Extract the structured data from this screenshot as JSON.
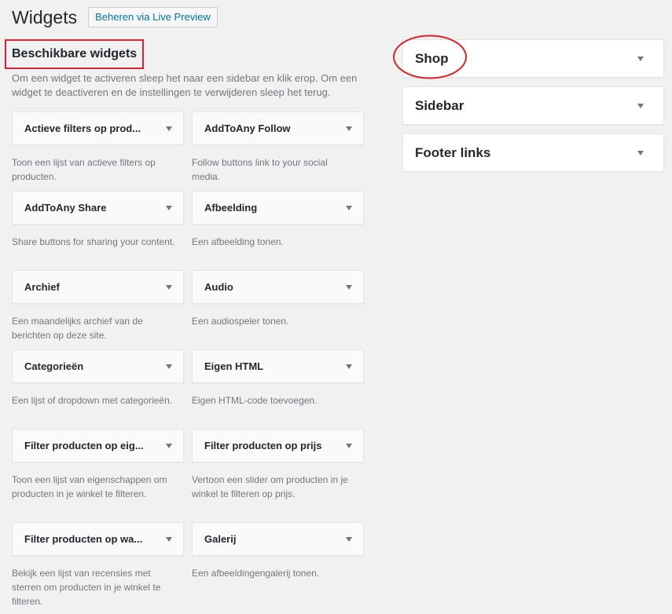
{
  "header": {
    "title": "Widgets",
    "live_preview_label": "Beheren via Live Preview"
  },
  "available": {
    "title": "Beschikbare widgets",
    "description": "Om een widget te activeren sleep het naar een sidebar en klik erop. Om een widget te deactiveren en de instellingen te verwijderen sleep het terug."
  },
  "widgets": [
    {
      "name": "Actieve filters op prod...",
      "desc": "Toon een lijst van actieve filters op producten."
    },
    {
      "name": "AddToAny Follow",
      "desc": "Follow buttons link to your social media."
    },
    {
      "name": "AddToAny Share",
      "desc": "Share buttons for sharing your content."
    },
    {
      "name": "Afbeelding",
      "desc": "Een afbeelding tonen."
    },
    {
      "name": "Archief",
      "desc": "Een maandelijks archief van de berichten op deze site."
    },
    {
      "name": "Audio",
      "desc": "Een audiospeler tonen."
    },
    {
      "name": "Categorieën",
      "desc": "Een lijst of dropdown met categorieën."
    },
    {
      "name": "Eigen HTML",
      "desc": "Eigen HTML-code toevoegen."
    },
    {
      "name": "Filter producten op eig...",
      "desc": "Toon een lijst van eigenschappen om producten in je winkel te filteren."
    },
    {
      "name": "Filter producten op prijs",
      "desc": "Vertoon een slider om producten in je winkel te filteren op prijs."
    },
    {
      "name": "Filter producten op wa...",
      "desc": "Bekijk een lijst van recensies met sterren om producten in je winkel te filteren."
    },
    {
      "name": "Galerij",
      "desc": "Een afbeeldingengalerij tonen."
    }
  ],
  "sidebars": [
    {
      "name": "Shop"
    },
    {
      "name": "Sidebar"
    },
    {
      "name": "Footer links"
    }
  ],
  "colors": {
    "annotation": "#d9232d",
    "link": "#0073aa"
  },
  "icons": {
    "widget_toggle": "arrow-down-icon"
  }
}
